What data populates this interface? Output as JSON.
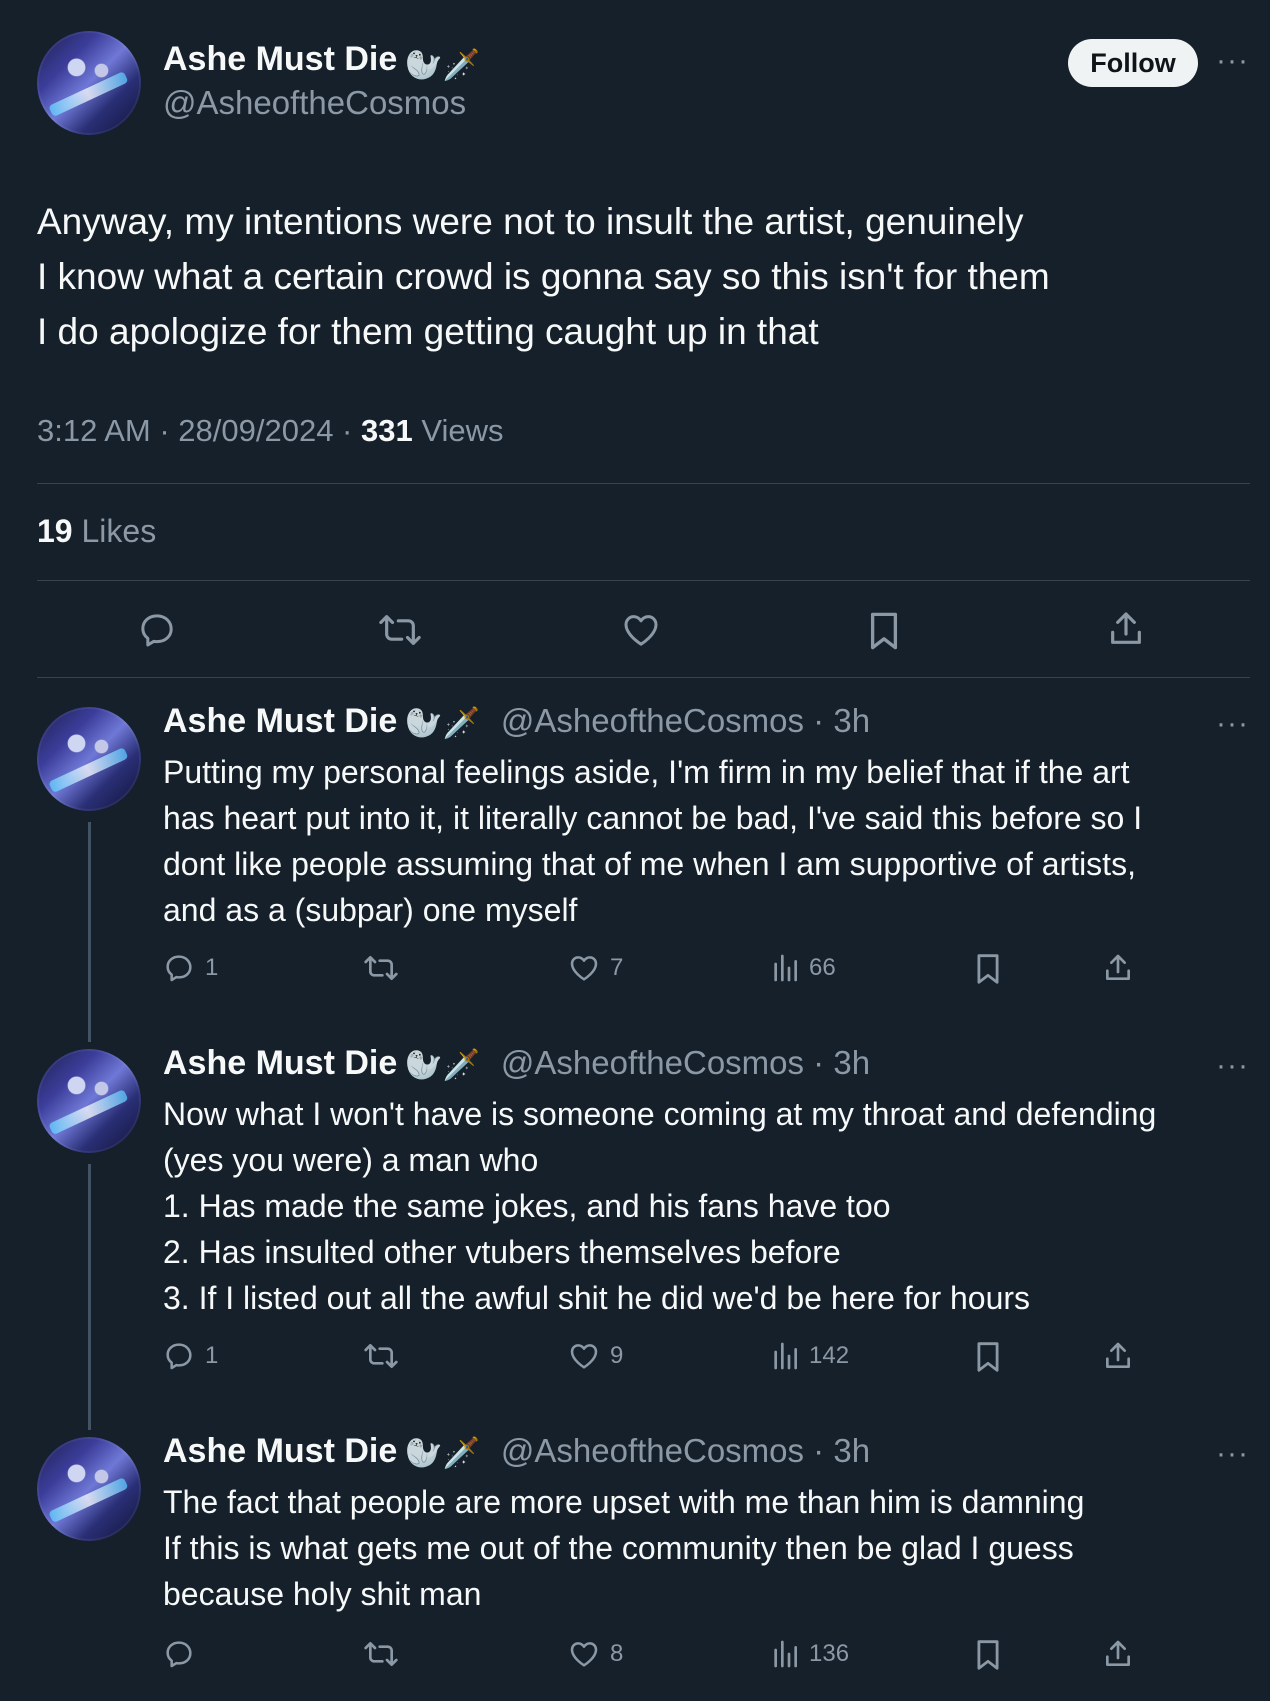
{
  "main_tweet": {
    "display_name": "Ashe Must Die",
    "emojis": "🦭🗡️",
    "handle": "@AsheoftheCosmos",
    "follow_label": "Follow",
    "more": "···",
    "lines": [
      "Anyway, my intentions were not to insult the artist, genuinely",
      "I know what a certain crowd is gonna say so this isn't for them",
      "I do apologize for them getting caught up in that"
    ],
    "time": "3:12 AM · 28/09/2024 · ",
    "views_count": "331",
    "views_label": " Views",
    "likes_count": "19",
    "likes_label": " Likes"
  },
  "replies": [
    {
      "display_name": "Ashe Must Die",
      "emojis": "🦭🗡️",
      "handle": "@AsheoftheCosmos · 3h",
      "more": "···",
      "lines": [
        "Putting my personal feelings aside, I'm firm in my belief that if the art",
        "has heart put into it, it literally cannot be bad, I've said this before so I",
        "dont like people assuming that of me when I am supportive of artists,",
        "and as a (subpar) one myself"
      ],
      "replies": "1",
      "likes": "7",
      "views": "66"
    },
    {
      "display_name": "Ashe Must Die",
      "emojis": "🦭🗡️",
      "handle": "@AsheoftheCosmos · 3h",
      "more": "···",
      "lines": [
        "Now what I won't have is someone coming at my throat and defending",
        "(yes you were) a man who",
        "1. Has made the same jokes, and his fans have too",
        "2. Has insulted other vtubers themselves before",
        "3. If I listed out all the awful shit he did we'd be here for hours"
      ],
      "replies": "1",
      "likes": "9",
      "views": "142"
    },
    {
      "display_name": "Ashe Must Die",
      "emojis": "🦭🗡️",
      "handle": "@AsheoftheCosmos · 3h",
      "more": "···",
      "lines": [
        "The fact that people are more upset with me than him is damning",
        "If this is what gets me out of the community then be glad I guess",
        "because holy shit man"
      ],
      "replies": "",
      "likes": "8",
      "views": "136"
    }
  ],
  "colors": {
    "background": "#15202b",
    "text": "#f7f9f9",
    "secondary": "#8b98a5",
    "divider": "#38444d"
  }
}
